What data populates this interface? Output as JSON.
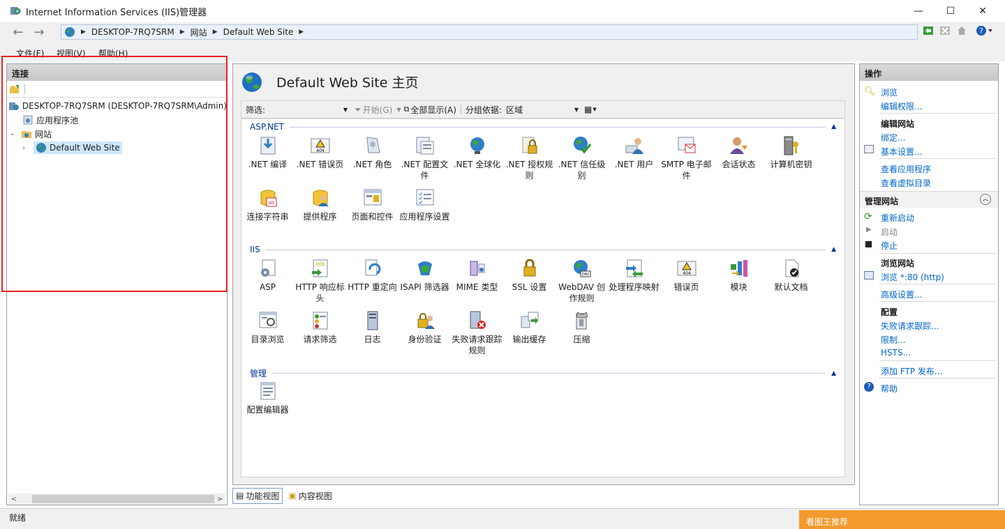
{
  "window": {
    "title": "Internet Information Services (IIS)管理器",
    "minimize": "—",
    "maximize": "☐",
    "close": "✕"
  },
  "address": {
    "segments": [
      "DESKTOP-7RQ7SRM",
      "网站",
      "Default Web Site"
    ]
  },
  "menu": [
    "文件(F)",
    "视图(V)",
    "帮助(H)"
  ],
  "connections": {
    "header": "连接",
    "tree": [
      {
        "label": "DESKTOP-7RQ7SRM (DESKTOP-7RQ7SRM\\Admin)",
        "icon": "server-icon"
      },
      {
        "label": "应用程序池",
        "icon": "app-pool-icon"
      },
      {
        "label": "网站",
        "icon": "sites-folder-icon"
      },
      {
        "label": "Default Web Site",
        "icon": "globe-icon",
        "selected": true
      }
    ]
  },
  "page": {
    "title": "Default Web Site 主页"
  },
  "filter": {
    "label": "筛选:",
    "go": "开始(G)",
    "showAll": "全部显示(A)",
    "groupBy": "分组依据:",
    "groupValue": "区域"
  },
  "sections": [
    {
      "name": "ASP.NET",
      "items": [
        ".NET 编译",
        ".NET 错误页",
        ".NET 角色",
        ".NET 配置文件",
        ".NET 全球化",
        ".NET 授权规则",
        ".NET 信任级别",
        ".NET 用户",
        "SMTP 电子邮件",
        "会话状态",
        "计算机密钥",
        "连接字符串",
        "提供程序",
        "页面和控件",
        "应用程序设置"
      ]
    },
    {
      "name": "IIS",
      "items": [
        "ASP",
        "HTTP 响应标头",
        "HTTP 重定向",
        "ISAPI 筛选器",
        "MIME 类型",
        "SSL 设置",
        "WebDAV 创作规则",
        "处理程序映射",
        "错误页",
        "模块",
        "默认文档",
        "目录浏览",
        "请求筛选",
        "日志",
        "身份验证",
        "失败请求跟踪规则",
        "输出缓存",
        "压缩"
      ]
    },
    {
      "name": "管理",
      "items": [
        "配置编辑器"
      ]
    }
  ],
  "actions": {
    "header": "操作",
    "browse": "浏览",
    "editPerm": "编辑权限...",
    "editSite": "编辑网站",
    "bindings": "绑定...",
    "basicSettings": "基本设置...",
    "viewApps": "查看应用程序",
    "viewVdirs": "查看虚拟目录",
    "manageSite": "管理网站",
    "restart": "重新启动",
    "start": "启动",
    "stop": "停止",
    "browseSite": "浏览网站",
    "browse80": "浏览 *:80 (http)",
    "advanced": "高级设置...",
    "config": "配置",
    "failedTrace": "失败请求跟踪...",
    "limits": "限制...",
    "hsts": "HSTS...",
    "addFtp": "添加 FTP 发布...",
    "help": "帮助"
  },
  "views": {
    "features": "功能视图",
    "content": "内容视图"
  },
  "status": {
    "text": "就绪"
  },
  "watermark": "看图王推荐"
}
